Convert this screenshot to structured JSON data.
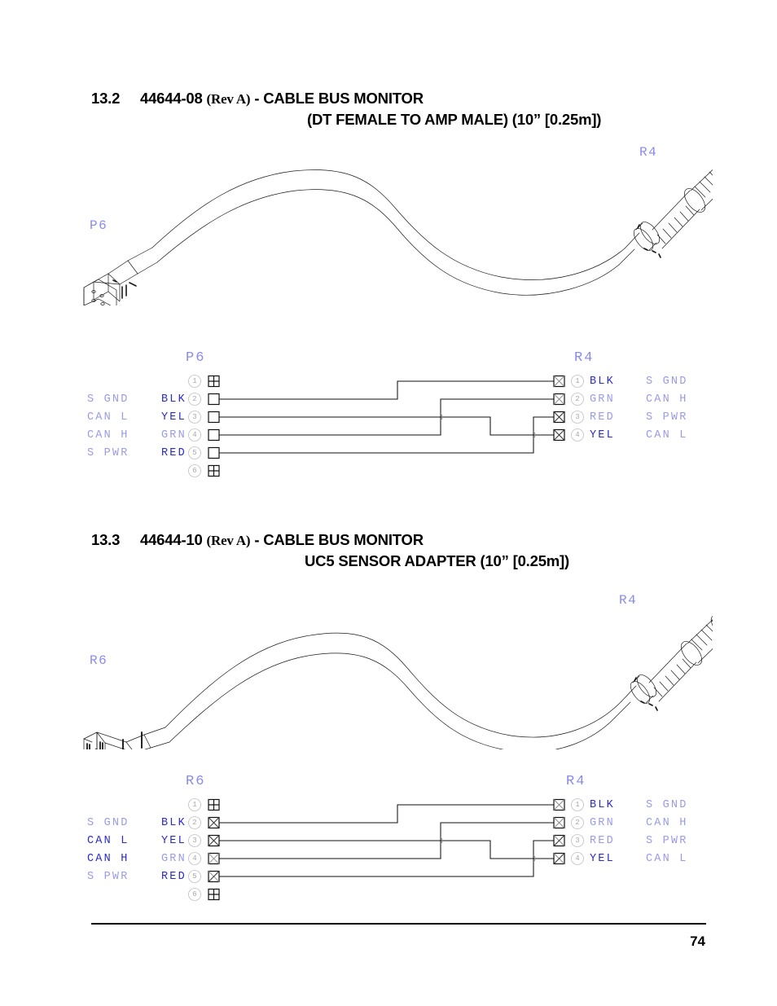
{
  "document": {
    "page_number": "74",
    "colors": {
      "wire_label": "#2a2aca",
      "function_label": "#9a9ae8",
      "connector_header": "#8a8aee",
      "pin_circle": "#b8b8b8",
      "line_art": "#000000"
    }
  },
  "sections": [
    {
      "number": "13.2",
      "title_line1_pre": "44644-08 ",
      "title_rev": "(Rev A)",
      "title_line1_post": " - CABLE BUS MONITOR",
      "title_line2": "(DT FEMALE TO AMP MALE) (10” [0.25m])",
      "illustration": {
        "left_connector_label": "P6",
        "right_connector_label": "R4",
        "description": "cable-assembly-isometric-line-drawing"
      },
      "schematic": {
        "left_header": "P6",
        "right_header": "R4",
        "left_terminals": [
          {
            "pin": "1",
            "symbol": "blank",
            "function": "",
            "wire": ""
          },
          {
            "pin": "2",
            "symbol": "open",
            "function": "S GND",
            "wire": "BLK"
          },
          {
            "pin": "3",
            "symbol": "open",
            "function": "CAN L",
            "wire": "YEL"
          },
          {
            "pin": "4",
            "symbol": "open",
            "function": "CAN H",
            "wire": "GRN"
          },
          {
            "pin": "5",
            "symbol": "open",
            "function": "S PWR",
            "wire": "RED"
          },
          {
            "pin": "6",
            "symbol": "blank",
            "function": "",
            "wire": ""
          }
        ],
        "right_terminals": [
          {
            "pin": "1",
            "symbol": "crossed",
            "wire": "BLK",
            "function": "S GND"
          },
          {
            "pin": "2",
            "symbol": "crossed",
            "wire": "GRN",
            "function": "CAN H"
          },
          {
            "pin": "3",
            "symbol": "crossed",
            "wire": "RED",
            "function": "S PWR"
          },
          {
            "pin": "4",
            "symbol": "crossed",
            "wire": "YEL",
            "function": "CAN L"
          }
        ],
        "connections": [
          {
            "from_pin": "2",
            "to_pin": "1",
            "wire": "BLK",
            "net": "S GND"
          },
          {
            "from_pin": "4",
            "to_pin": "2",
            "wire": "GRN",
            "net": "CAN H"
          },
          {
            "from_pin": "5",
            "to_pin": "3",
            "wire": "RED",
            "net": "S PWR"
          },
          {
            "from_pin": "3",
            "to_pin": "4",
            "wire": "YEL",
            "net": "CAN L"
          }
        ]
      }
    },
    {
      "number": "13.3",
      "title_line1_pre": "44644-10 ",
      "title_rev": "(Rev A)",
      "title_line1_post": " - CABLE BUS MONITOR",
      "title_line2": "UC5 SENSOR ADAPTER (10” [0.25m])",
      "illustration": {
        "left_connector_label": "R6",
        "right_connector_label": "R4",
        "description": "cable-assembly-isometric-line-drawing"
      },
      "schematic": {
        "left_header": "R6",
        "right_header": "R4",
        "left_terminals": [
          {
            "pin": "1",
            "symbol": "blank",
            "function": "",
            "wire": ""
          },
          {
            "pin": "2",
            "symbol": "crossed",
            "function": "S GND",
            "wire": "BLK"
          },
          {
            "pin": "3",
            "symbol": "crossed",
            "function": "CAN L",
            "wire": "YEL"
          },
          {
            "pin": "4",
            "symbol": "crossed",
            "function": "CAN H",
            "wire": "GRN"
          },
          {
            "pin": "5",
            "symbol": "crossed",
            "function": "S PWR",
            "wire": "RED"
          },
          {
            "pin": "6",
            "symbol": "blank",
            "function": "",
            "wire": ""
          }
        ],
        "right_terminals": [
          {
            "pin": "1",
            "symbol": "crossed",
            "wire": "BLK",
            "function": "S GND"
          },
          {
            "pin": "2",
            "symbol": "crossed",
            "wire": "GRN",
            "function": "CAN H"
          },
          {
            "pin": "3",
            "symbol": "crossed",
            "wire": "RED",
            "function": "S PWR"
          },
          {
            "pin": "4",
            "symbol": "crossed",
            "wire": "YEL",
            "function": "CAN L"
          }
        ],
        "connections": [
          {
            "from_pin": "2",
            "to_pin": "1",
            "wire": "BLK",
            "net": "S GND"
          },
          {
            "from_pin": "4",
            "to_pin": "2",
            "wire": "GRN",
            "net": "CAN H"
          },
          {
            "from_pin": "3",
            "to_pin": "3",
            "wire": "YEL",
            "net": "CAN L"
          },
          {
            "from_pin": "5",
            "to_pin": "4",
            "wire": "RED",
            "net": "S PWR"
          }
        ]
      }
    }
  ]
}
